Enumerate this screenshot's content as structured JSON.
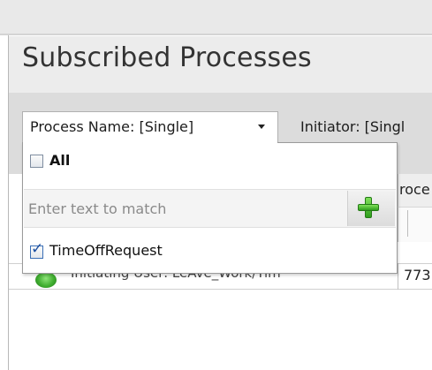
{
  "panel": {
    "title": "Subscribed Processes"
  },
  "filters": {
    "process_name_label": "Process Name: [Single]",
    "initiator_label": "Initiator: [Singl"
  },
  "dropdown": {
    "all_label": "All",
    "all_checked": false,
    "search_placeholder": "Enter text to match",
    "search_value": "",
    "items": [
      {
        "label": "TimeOffRequest",
        "checked": true
      }
    ]
  },
  "grid": {
    "header_partial": "roce",
    "row_partial_value": "773",
    "row_partial_text": "Initiating User: LeAve_Work/Tim"
  },
  "icons": {
    "dropdown_arrow": "chevron-down-icon",
    "add": "plus-icon",
    "status": "status-green-icon",
    "checkmark": "checkmark-icon"
  },
  "colors": {
    "panel_header_bg": "#ececec",
    "filterbar_bg": "#dcdcdc",
    "add_icon_green": "#3fae2f",
    "checkbox_check": "#1d4fa0",
    "status_green": "#3fae2f"
  }
}
